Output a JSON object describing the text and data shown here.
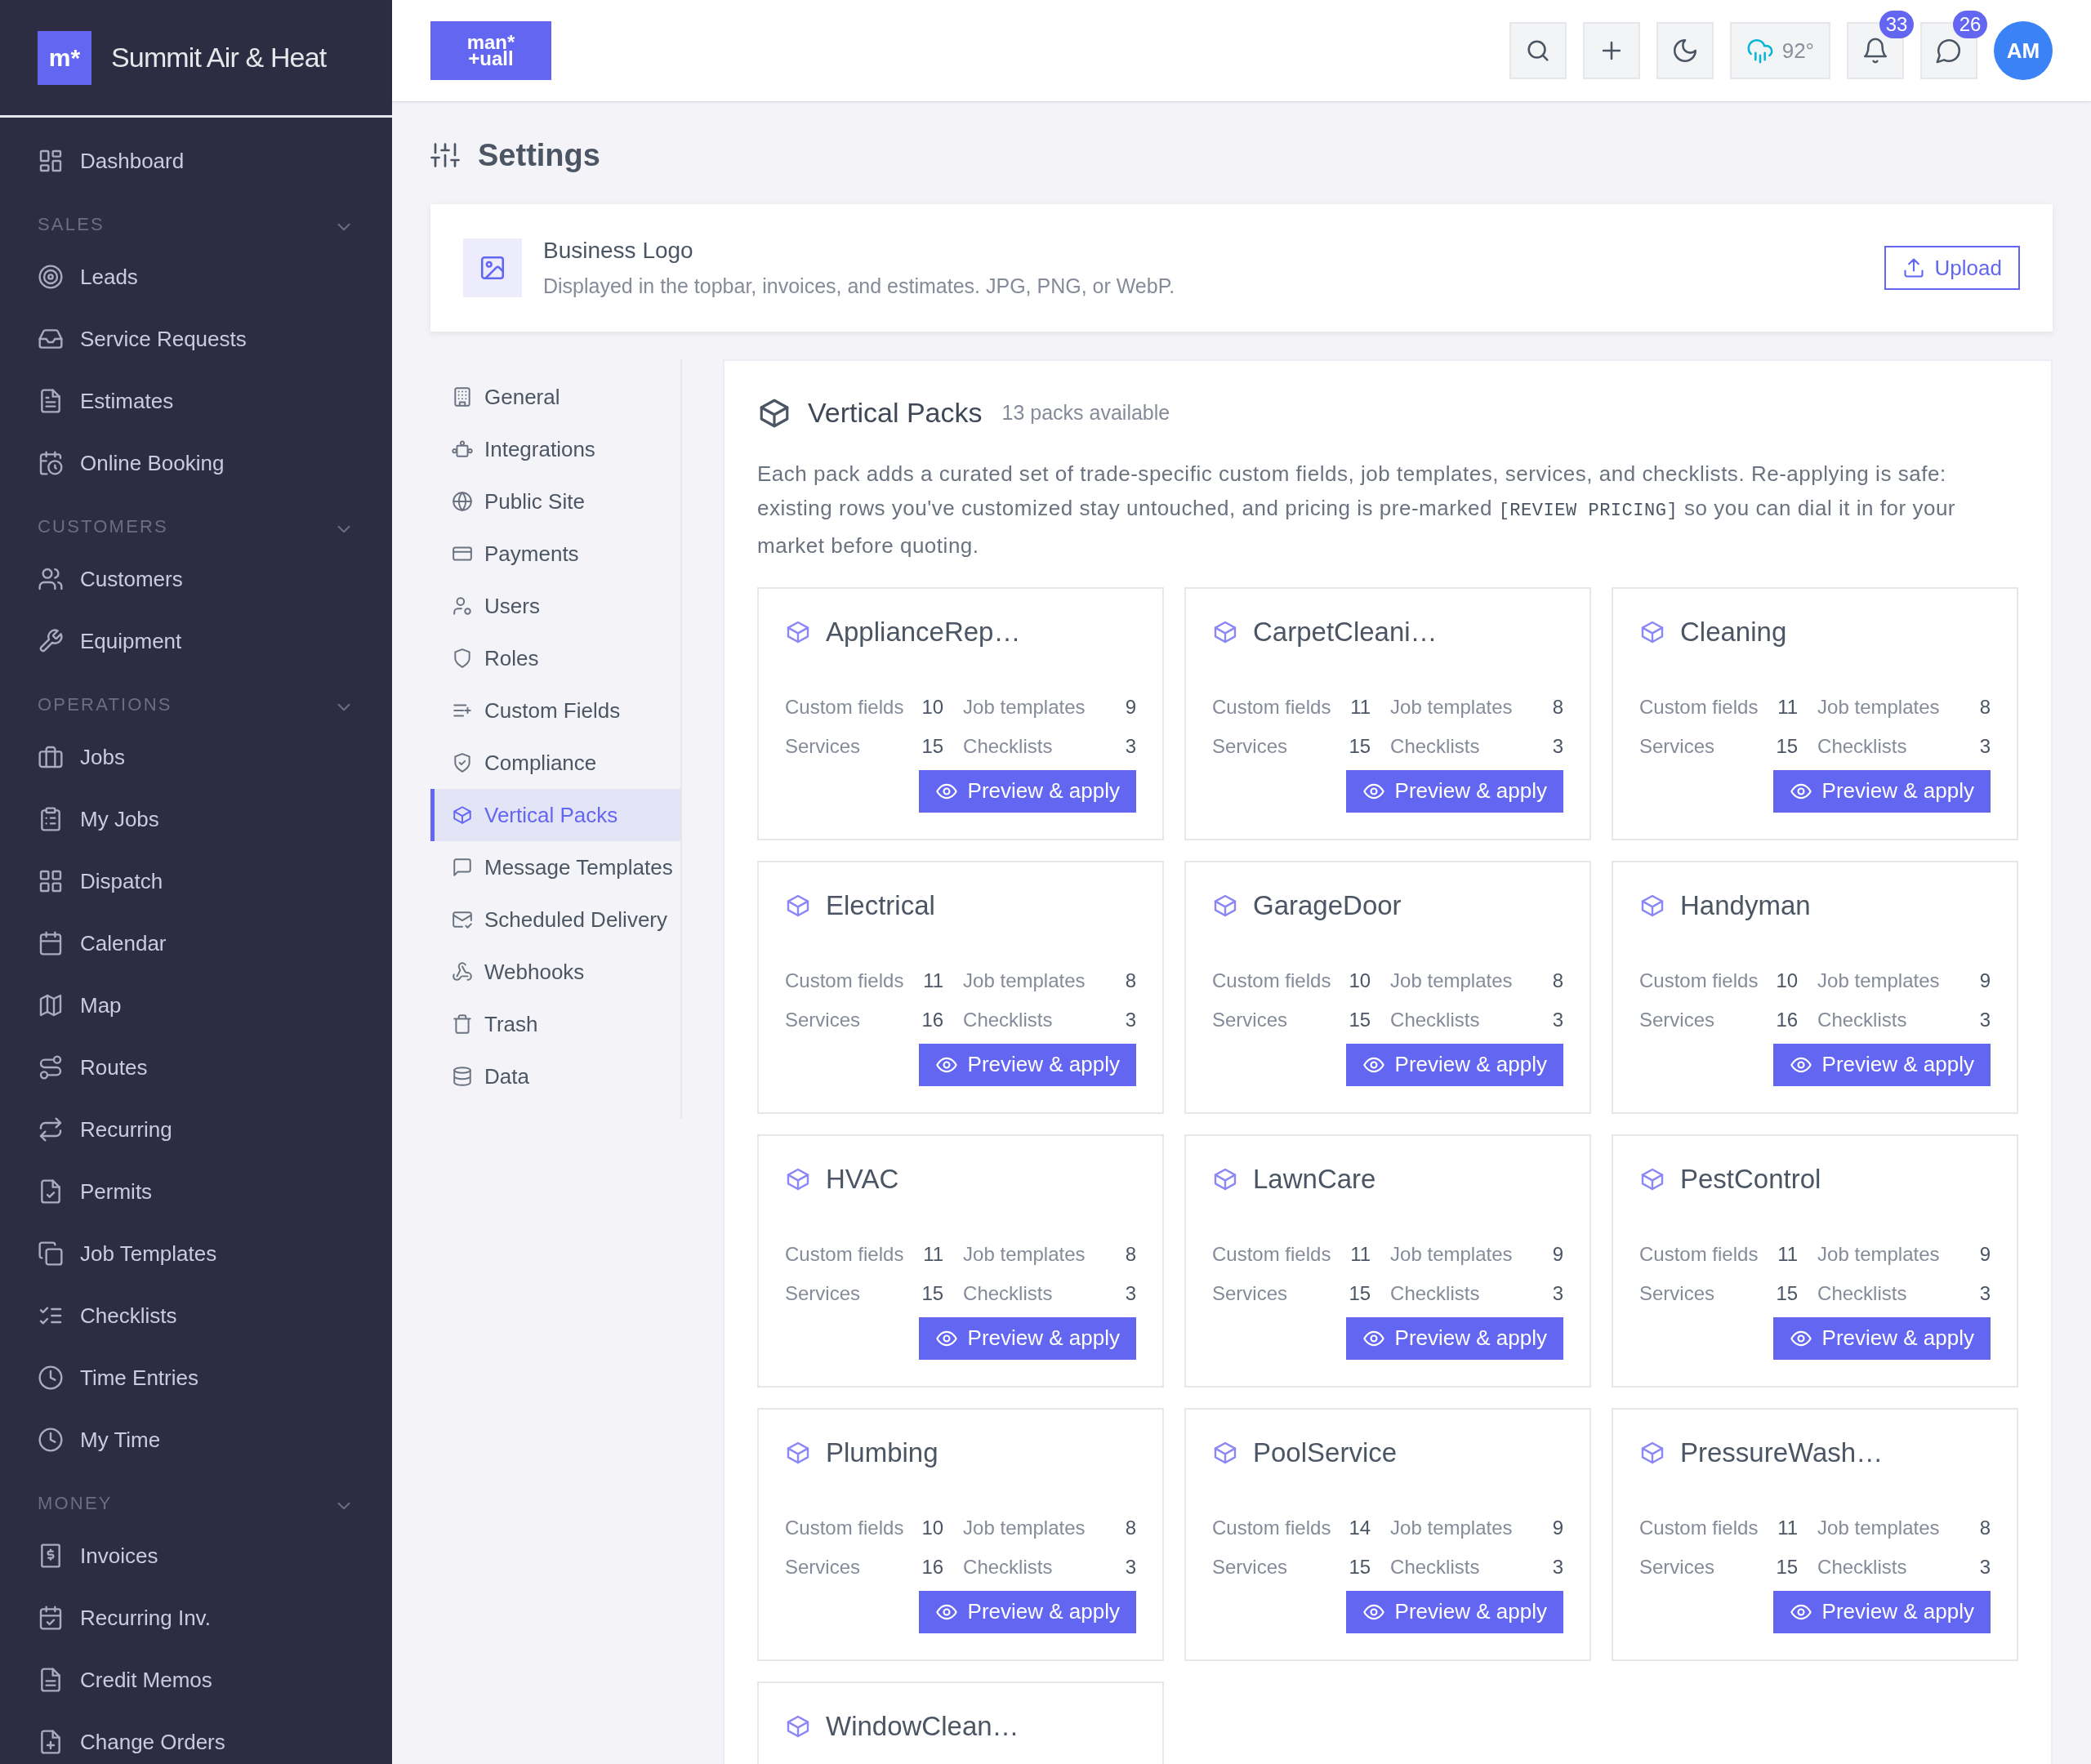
{
  "sidebar": {
    "brand": {
      "logo_text": "m*",
      "name": "Summit Air & Heat"
    },
    "sections": [
      {
        "items": [
          {
            "label": "Dashboard"
          }
        ]
      },
      {
        "title": "SALES",
        "expanded": true,
        "items": [
          {
            "label": "Leads"
          },
          {
            "label": "Service Requests"
          },
          {
            "label": "Estimates"
          },
          {
            "label": "Online Booking"
          }
        ]
      },
      {
        "title": "CUSTOMERS",
        "expanded": true,
        "items": [
          {
            "label": "Customers"
          },
          {
            "label": "Equipment"
          }
        ]
      },
      {
        "title": "OPERATIONS",
        "expanded": true,
        "items": [
          {
            "label": "Jobs"
          },
          {
            "label": "My Jobs"
          },
          {
            "label": "Dispatch"
          },
          {
            "label": "Calendar"
          },
          {
            "label": "Map"
          },
          {
            "label": "Routes"
          },
          {
            "label": "Recurring"
          },
          {
            "label": "Permits"
          },
          {
            "label": "Job Templates"
          },
          {
            "label": "Checklists"
          },
          {
            "label": "Time Entries"
          },
          {
            "label": "My Time"
          }
        ]
      },
      {
        "title": "MONEY",
        "expanded": true,
        "items": [
          {
            "label": "Invoices"
          },
          {
            "label": "Recurring Inv."
          },
          {
            "label": "Credit Memos"
          },
          {
            "label": "Change Orders"
          }
        ]
      }
    ]
  },
  "topbar": {
    "logo_lines": [
      "man*",
      "+uall"
    ],
    "weather": "92°",
    "notifications": "33",
    "messages": "26",
    "avatar": "AM"
  },
  "page_title": "Settings",
  "business_logo": {
    "title": "Business Logo",
    "description": "Displayed in the topbar, invoices, and estimates. JPG, PNG, or WebP.",
    "button": "Upload"
  },
  "settings_nav": [
    {
      "label": "General",
      "selected": false
    },
    {
      "label": "Integrations",
      "selected": false
    },
    {
      "label": "Public Site",
      "selected": false
    },
    {
      "label": "Payments",
      "selected": false
    },
    {
      "label": "Users",
      "selected": false
    },
    {
      "label": "Roles",
      "selected": false
    },
    {
      "label": "Custom Fields",
      "selected": false
    },
    {
      "label": "Compliance",
      "selected": false
    },
    {
      "label": "Vertical Packs",
      "selected": true
    },
    {
      "label": "Message Templates",
      "selected": false
    },
    {
      "label": "Scheduled Delivery",
      "selected": false
    },
    {
      "label": "Webhooks",
      "selected": false
    },
    {
      "label": "Trash",
      "selected": false
    },
    {
      "label": "Data",
      "selected": false
    }
  ],
  "vertical_packs": {
    "title": "Vertical Packs",
    "count": "13 packs available",
    "description": [
      {
        "kind": "text",
        "text": "Each pack adds a curated set of trade-specific custom fields, job templates, services, and checklists. Re-applying is safe: existing rows you've customized stay untouched, and pricing is pre-marked "
      },
      {
        "kind": "code",
        "text": "[REVIEW PRICING]"
      },
      {
        "kind": "text",
        "text": " so you can dial it in for your market before quoting."
      }
    ],
    "packs": [
      {
        "title": "ApplianceRep…",
        "stats": [
          {
            "label": "Custom fields",
            "value": "10"
          },
          {
            "label": "Job templates",
            "value": "9"
          },
          {
            "label": "Services",
            "value": "15"
          },
          {
            "label": "Checklists",
            "value": "3"
          }
        ],
        "button": "Preview & apply"
      },
      {
        "title": "CarpetCleani…",
        "stats": [
          {
            "label": "Custom fields",
            "value": "11"
          },
          {
            "label": "Job templates",
            "value": "8"
          },
          {
            "label": "Services",
            "value": "15"
          },
          {
            "label": "Checklists",
            "value": "3"
          }
        ],
        "button": "Preview & apply"
      },
      {
        "title": "Cleaning",
        "stats": [
          {
            "label": "Custom fields",
            "value": "11"
          },
          {
            "label": "Job templates",
            "value": "8"
          },
          {
            "label": "Services",
            "value": "15"
          },
          {
            "label": "Checklists",
            "value": "3"
          }
        ],
        "button": "Preview & apply"
      },
      {
        "title": "Electrical",
        "stats": [
          {
            "label": "Custom fields",
            "value": "11"
          },
          {
            "label": "Job templates",
            "value": "8"
          },
          {
            "label": "Services",
            "value": "16"
          },
          {
            "label": "Checklists",
            "value": "3"
          }
        ],
        "button": "Preview & apply"
      },
      {
        "title": "GarageDoor",
        "stats": [
          {
            "label": "Custom fields",
            "value": "10"
          },
          {
            "label": "Job templates",
            "value": "8"
          },
          {
            "label": "Services",
            "value": "15"
          },
          {
            "label": "Checklists",
            "value": "3"
          }
        ],
        "button": "Preview & apply"
      },
      {
        "title": "Handyman",
        "stats": [
          {
            "label": "Custom fields",
            "value": "10"
          },
          {
            "label": "Job templates",
            "value": "9"
          },
          {
            "label": "Services",
            "value": "16"
          },
          {
            "label": "Checklists",
            "value": "3"
          }
        ],
        "button": "Preview & apply"
      },
      {
        "title": "HVAC",
        "stats": [
          {
            "label": "Custom fields",
            "value": "11"
          },
          {
            "label": "Job templates",
            "value": "8"
          },
          {
            "label": "Services",
            "value": "15"
          },
          {
            "label": "Checklists",
            "value": "3"
          }
        ],
        "button": "Preview & apply"
      },
      {
        "title": "LawnCare",
        "stats": [
          {
            "label": "Custom fields",
            "value": "11"
          },
          {
            "label": "Job templates",
            "value": "9"
          },
          {
            "label": "Services",
            "value": "15"
          },
          {
            "label": "Checklists",
            "value": "3"
          }
        ],
        "button": "Preview & apply"
      },
      {
        "title": "PestControl",
        "stats": [
          {
            "label": "Custom fields",
            "value": "11"
          },
          {
            "label": "Job templates",
            "value": "9"
          },
          {
            "label": "Services",
            "value": "15"
          },
          {
            "label": "Checklists",
            "value": "3"
          }
        ],
        "button": "Preview & apply"
      },
      {
        "title": "Plumbing",
        "stats": [
          {
            "label": "Custom fields",
            "value": "10"
          },
          {
            "label": "Job templates",
            "value": "8"
          },
          {
            "label": "Services",
            "value": "16"
          },
          {
            "label": "Checklists",
            "value": "3"
          }
        ],
        "button": "Preview & apply"
      },
      {
        "title": "PoolService",
        "stats": [
          {
            "label": "Custom fields",
            "value": "14"
          },
          {
            "label": "Job templates",
            "value": "9"
          },
          {
            "label": "Services",
            "value": "15"
          },
          {
            "label": "Checklists",
            "value": "3"
          }
        ],
        "button": "Preview & apply"
      },
      {
        "title": "PressureWash…",
        "stats": [
          {
            "label": "Custom fields",
            "value": "11"
          },
          {
            "label": "Job templates",
            "value": "8"
          },
          {
            "label": "Services",
            "value": "15"
          },
          {
            "label": "Checklists",
            "value": "3"
          }
        ],
        "button": "Preview & apply"
      },
      {
        "title": "WindowClean…"
      }
    ]
  }
}
